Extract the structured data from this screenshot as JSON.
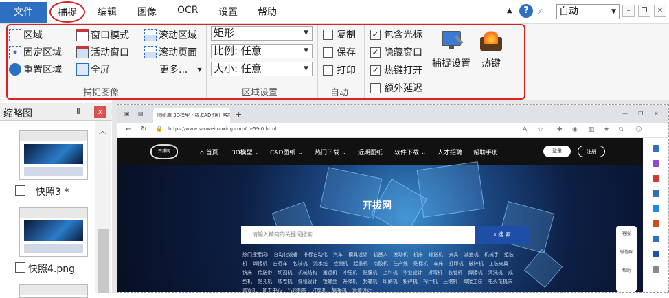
{
  "menu": {
    "items": [
      "文件",
      "捕捉",
      "编辑",
      "图像",
      "OCR",
      "设置",
      "帮助"
    ],
    "mode_value": "自动"
  },
  "ribbon": {
    "capture_group": {
      "title": "捕捉图像",
      "col1": [
        "区域",
        "固定区域",
        "重置区域"
      ],
      "col2": [
        "窗口模式",
        "活动窗口",
        "全屏"
      ],
      "col3": [
        "滚动区域",
        "滚动页面",
        "更多..."
      ]
    },
    "region_group": {
      "title": "区域设置",
      "shape": "矩形",
      "ratio": "比例: 任意",
      "size": "大小: 任意"
    },
    "auto_group": {
      "title": "自动",
      "options": [
        {
          "label": "复制",
          "checked": false
        },
        {
          "label": "保存",
          "checked": false
        },
        {
          "label": "打印",
          "checked": false
        }
      ]
    },
    "options_group": {
      "options": [
        {
          "label": "包含光标",
          "checked": true
        },
        {
          "label": "隐藏窗口",
          "checked": true
        },
        {
          "label": "热键打开",
          "checked": true
        },
        {
          "label": "额外延迟",
          "checked": false
        }
      ],
      "capture_settings_label": "捕捉设置",
      "hotkey_label": "热键"
    }
  },
  "thumbnails": {
    "title": "缩略图",
    "pin_glyph": "Ⅱ",
    "close_glyph": "x",
    "items": [
      {
        "label": "快照3 *"
      },
      {
        "label": "快照4.png"
      }
    ]
  },
  "browser": {
    "tab_title": "图纸库 3D模型下载,CAD图纸下载...",
    "url": "https://www.sanweimoxing.com/tu-59-0.html",
    "logo": "开拔网",
    "nav": [
      "首页",
      "3D模型 ⌄",
      "CAD图纸 ⌄",
      "热门下载 ⌄",
      "近期图纸",
      "软件下载 ⌄",
      "人才招聘",
      "帮助手册"
    ],
    "login": "登录",
    "register": "注册",
    "hero_title": "开拔网",
    "search_placeholder": "请输入精简的关键词搜索...",
    "search_button": "搜 索",
    "hot_searches": "热门搜索词: 自动化设备 非标自动化 汽车 模具设计 机器人 发动机 机床 输送机 夹具 减速机 机械手 组装机 焊接机 自行车 包装机 流水线 检测机 起重机 点胶机 生产线 贴标机 车床 打印机 破碎机 工装夹具 铣床 传送带 切割机 机械结构 搬运机 冲压机 贴膜机 上料机 毕业设计 折弯机 收卷机 焊接机 清洗机 成型机 钻孔机 收卷机 课程设计 锁螺丝 升降机 封箱机 印刷机 粉碎机 榨汁机 压缩机 焊接工装 电火花机床 弯管机 加工中心 凸轮机构 注塑机 铆接机 管道设计",
    "side_float": [
      "客服",
      "微信群",
      "帮助"
    ]
  },
  "colors": {
    "accent": "#2e6fc1",
    "highlight": "#e02020",
    "file_menu_bg": "#2e6fc1"
  }
}
